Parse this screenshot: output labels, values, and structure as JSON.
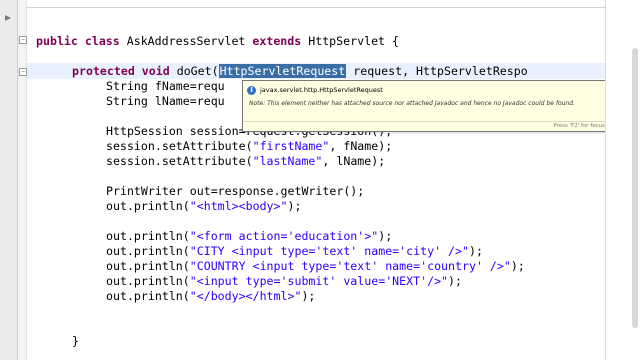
{
  "editor": {
    "lines": {
      "l1": {
        "kw1": "public class",
        "t1": " AskAddressServlet ",
        "kw2": "extends",
        "t2": " HttpServlet {"
      },
      "l2": {
        "kw1": "protected void",
        "t1": " doGet(",
        "sel": "HttpServletRequest",
        "t2": " request, HttpServletRespo"
      },
      "l3": {
        "t1": "String fName=requ"
      },
      "l4": {
        "t1": "String lName=requ"
      },
      "l5": {
        "t1": "HttpSession session=request.getSession();"
      },
      "l6": {
        "t1": "session.setAttribute(",
        "s1": "\"firstName\"",
        "t2": ", fName);"
      },
      "l7": {
        "t1": "session.setAttribute(",
        "s1": "\"lastName\"",
        "t2": ", lName);"
      },
      "l8": {
        "t1": "PrintWriter out=response.getWriter();"
      },
      "l9": {
        "t1": "out.println(",
        "s1": "\"<html><body>\"",
        "t2": ");"
      },
      "l10": {
        "t1": "out.println(",
        "s1": "\"<form action='education'>\"",
        "t2": ");"
      },
      "l11": {
        "t1": "out.println(",
        "s1": "\"CITY <input type='text' name='city' />\"",
        "t2": ");"
      },
      "l12": {
        "t1": "out.println(",
        "s1": "\"COUNTRY <input type='text' name='country' />\"",
        "t2": ");"
      },
      "l13": {
        "t1": "out.println(",
        "s1": "\"<input type='submit' value='NEXT'/>\"",
        "t2": ");"
      },
      "l14": {
        "t1": "out.println(",
        "s1": "\"</body></html>\"",
        "t2": ");"
      },
      "l15": {
        "t1": "}"
      }
    }
  },
  "hover": {
    "icon": "class-icon",
    "title": "javax.servlet.http.HttpServletRequest",
    "note": "Note: This element neither has attached source nor attached Javadoc and hence no Javadoc could be found.",
    "footer": "Press 'F2' for focus"
  },
  "colors": {
    "keyword": "#7f0055",
    "string": "#2a00ff",
    "selection": "#3a6ea5",
    "tooltip_bg": "#ffffe1",
    "current_line": "#e8f2fe"
  }
}
